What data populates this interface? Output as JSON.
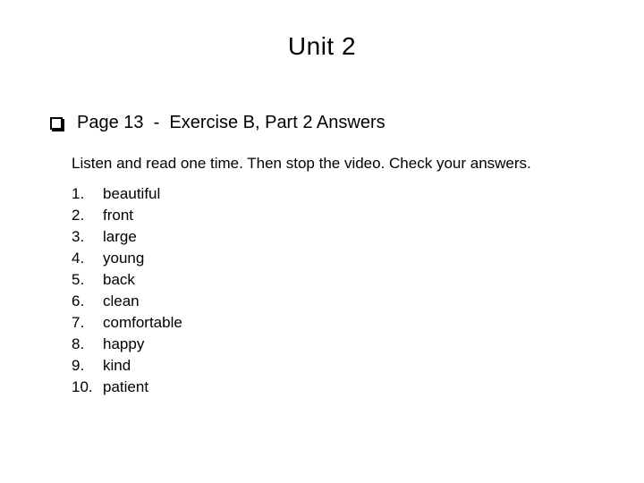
{
  "title": "Unit 2",
  "heading": "Page 13  -  Exercise B, Part 2 Answers",
  "instructions": "Listen and read one time. Then stop the video. Check your answers.",
  "answers": [
    {
      "num": "1.",
      "word": "beautiful"
    },
    {
      "num": "2.",
      "word": "front"
    },
    {
      "num": "3.",
      "word": "large"
    },
    {
      "num": "4.",
      "word": "young"
    },
    {
      "num": "5.",
      "word": "back"
    },
    {
      "num": "6.",
      "word": "clean"
    },
    {
      "num": "7.",
      "word": "comfortable"
    },
    {
      "num": "8.",
      "word": "happy"
    },
    {
      "num": "9.",
      "word": "kind"
    },
    {
      "num": "10.",
      "word": "patient"
    }
  ]
}
